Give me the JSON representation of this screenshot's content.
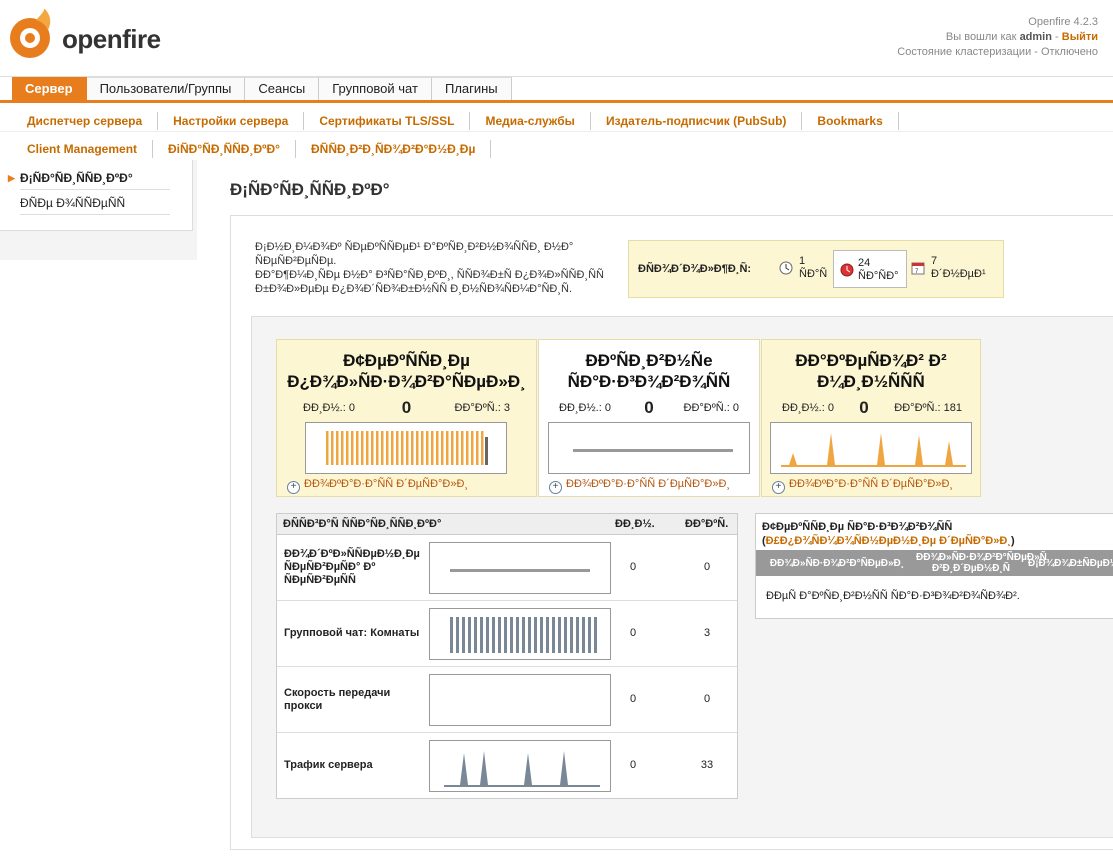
{
  "header": {
    "logo_text": "openfire",
    "version": "Openfire 4.2.3",
    "logged_in_prefix": "Вы вошли как",
    "username": "admin",
    "separator": " - ",
    "logout": "Выйти",
    "cluster_status": "Состояние кластеризации - Отключено"
  },
  "main_tabs": [
    {
      "label": "Сервер",
      "active": true
    },
    {
      "label": "Пользователи/Группы",
      "active": false
    },
    {
      "label": "Сеансы",
      "active": false
    },
    {
      "label": "Групповой чат",
      "active": false
    },
    {
      "label": "Плагины",
      "active": false
    }
  ],
  "sub_tabs_row1": [
    "Диспетчер сервера",
    "Настройки сервера",
    "Сертификаты TLS/SSL",
    "Медиа-службы",
    "Издатель-подписчик (PubSub)",
    "Bookmarks"
  ],
  "sub_tabs_row2": [
    "Client Management",
    "ÐiÑÐ°ÑÐ¸ÑÑÐ¸ÐºÐ°",
    "ÐÑÑÐ¸Ð²Ð¸ÑÐ¾Ð²Ð°Ð½Ð¸Ðµ"
  ],
  "sidebar": {
    "items": [
      {
        "label": "Ð¡ÑÐ°ÑÐ¸ÑÑÐ¸ÐºÐ°",
        "active": true
      },
      {
        "label": "ÐÑÐµ Ð¾ÑÑÐµÑÑ",
        "active": false
      }
    ]
  },
  "page": {
    "title": "Ð¡ÑÐ°ÑÐ¸ÑÑÐ¸ÐºÐ°",
    "intro_line1": "Ð¡Ð½Ð¸Ð¼Ð¾Ðº ÑÐµÐºÑÑÐµÐ¹ Ð°ÐºÑÐ¸Ð²Ð½Ð¾ÑÑÐ¸ Ð½Ð° ÑÐµÑÐ²ÐµÑÐµ.",
    "intro_line2": "ÐÐ°Ð¶Ð¼Ð¸ÑÐµ Ð½Ð° Ð³ÑÐ°ÑÐ¸ÐºÐ¸, ÑÑÐ¾Ð±Ñ Ð¿Ð¾Ð»ÑÑÐ¸ÑÑ Ð±Ð¾Ð»ÐµÐµ Ð¿Ð¾Ð´ÑÐ¾Ð±Ð½ÑÑ Ð¸Ð½ÑÐ¾ÑÐ¼Ð°ÑÐ¸Ñ."
  },
  "timebox": {
    "label": "ÐÑÐ¾Ð´Ð¾Ð»Ð¶Ð¸Ñ:",
    "options": [
      {
        "num": "1",
        "unit": "ÑÐ°Ñ",
        "selected": false,
        "icon": "clock-icon"
      },
      {
        "num": "24",
        "unit": "ÑÐ°ÑÐ°",
        "selected": true,
        "icon": "clock-red-icon"
      },
      {
        "num": "7",
        "unit": "Ð´Ð½ÐµÐ¹",
        "selected": false,
        "icon": "calendar-icon"
      }
    ]
  },
  "cards": [
    {
      "title_line1": "Ð¢ÐµÐºÑÑÐ¸Ðµ",
      "title_line2": "Ð¿Ð¾Ð»ÑÐ·Ð¾Ð²Ð°ÑÐµÐ»Ð¸",
      "min_label": "ÐÐ¸Ð½.: 0",
      "current": "0",
      "max_label": "ÐÐ°ÐºÑ.: 3",
      "link": "ÐÐ¾ÐºÐ°Ð·Ð°ÑÑ Ð´ÐµÑÐ°Ð»Ð¸",
      "selected": false
    },
    {
      "title_line1": "ÐÐºÑÐ¸Ð²Ð½Ñе",
      "title_line2": "ÑÐ°Ð·Ð³Ð¾Ð²Ð¾ÑÑ",
      "min_label": "ÐÐ¸Ð½.: 0",
      "current": "0",
      "max_label": "ÐÐ°ÐºÑ.: 0",
      "link": "ÐÐ¾ÐºÐ°Ð·Ð°ÑÑ Ð´ÐµÑÐ°Ð»Ð¸",
      "selected": true
    },
    {
      "title_line1": "ÐÐ°ÐºÐµÑÐ¾Ð² Ð²",
      "title_line2": "Ð¼Ð¸Ð½ÑÑÑ",
      "min_label": "ÐÐ¸Ð½.: 0",
      "current": "0",
      "max_label": "ÐÐ°ÐºÑ.: 181",
      "link": "ÐÐ¾ÐºÐ°Ð·Ð°ÑÑ Ð´ÐµÑÐ°Ð»Ð¸",
      "selected": false
    }
  ],
  "stats_table": {
    "head_label": "ÐÑÑÐ³Ð°Ñ ÑÑÐ°ÑÐ¸ÑÑÐ¸ÐºÐ°",
    "head_min": "ÐÐ¸Ð½.",
    "head_max": "ÐÐ°ÐºÑ.",
    "rows": [
      {
        "label": "ÐÐ¾Ð´ÐºÐ»ÑÑÐµÐ½Ð¸Ðµ ÑÐµÑÐ²ÐµÑÐ° Ðº ÑÐµÑÐ²ÐµÑÑ",
        "min": "0",
        "max": "0",
        "spark": "flat"
      },
      {
        "label": "Групповой чат: Комнаты",
        "min": "0",
        "max": "3",
        "spark": "bars"
      },
      {
        "label": "Скорость передачи прокси",
        "min": "0",
        "max": "0",
        "spark": "empty"
      },
      {
        "label": "Трафик сервера",
        "min": "0",
        "max": "33",
        "spark": "peaks"
      }
    ]
  },
  "conn_box": {
    "title": "Ð¢ÐµÐºÑÑÐ¸Ðµ ÑÐ°Ð·Ð³Ð¾Ð²Ð¾ÑÑ",
    "link": "Ð£Ð¿Ð¾ÑÐ¼Ð¾ÑÐ½ÐµÐ½Ð¸Ðµ Ð´ÐµÑÐ°Ð»Ð¸",
    "col1": "ÐÐ¾Ð»ÑÐ·Ð¾Ð²Ð°ÑÐµÐ»Ð¸",
    "col2": "ÐÐ¾Ð»ÑÐ·Ð¾Ð²Ð°ÑÐµÐ»Ñ Ð²Ð¸Ð´ÐµÐ½Ð¸Ñ",
    "col3": "Ð¡Ð¾Ð¾Ð±ÑÐµÐ½Ð¸Ñ",
    "empty": "ÐÐµÑ Ð°ÐºÑÐ¸Ð²Ð½ÑÑ ÑÐ°Ð·Ð³Ð¾Ð²Ð¾ÑÐ¾Ð²."
  },
  "colors": {
    "accent": "#e87d1e",
    "link": "#c66b00",
    "spark_orange": "#f0a640",
    "spark_gray": "#7a8797"
  }
}
